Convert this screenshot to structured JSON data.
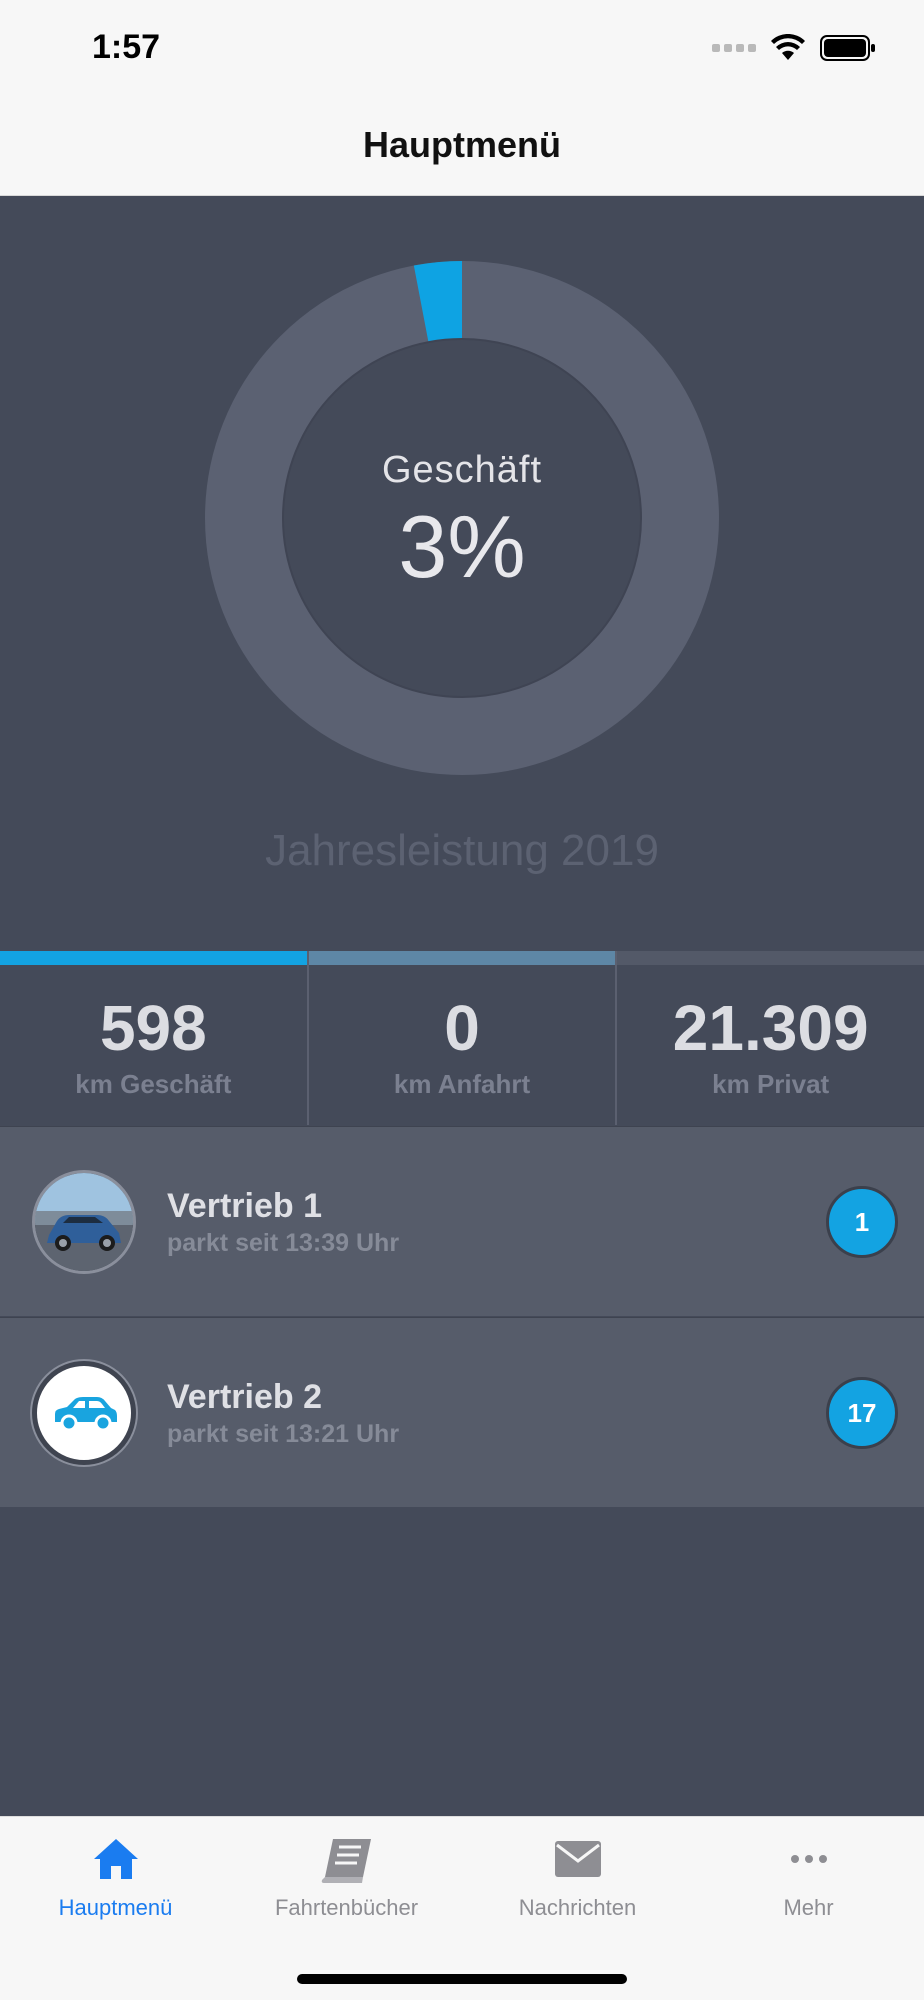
{
  "status_bar": {
    "time": "1:57"
  },
  "nav": {
    "title": "Hauptmenü"
  },
  "donut": {
    "label": "Geschäft",
    "value_text": "3%",
    "fraction": 0.03,
    "year_label": "Jahresleistung 2019"
  },
  "stats": [
    {
      "value": "598",
      "label": "km Geschäft",
      "bar_color": "#13a3e2"
    },
    {
      "value": "0",
      "label": "km Anfahrt",
      "bar_color": "#5e87a6"
    },
    {
      "value": "21.309",
      "label": "km Privat",
      "bar_color": "#535968"
    }
  ],
  "vehicles": [
    {
      "name": "Vertrieb 1",
      "status": "parkt seit 13:39 Uhr",
      "badge": "1",
      "avatar": "car-photo"
    },
    {
      "name": "Vertrieb 2",
      "status": "parkt seit 13:21 Uhr",
      "badge": "17",
      "avatar": "car-icon"
    }
  ],
  "tabs": [
    {
      "label": "Hauptmenü",
      "icon": "home-icon",
      "active": true
    },
    {
      "label": "Fahrtenbücher",
      "icon": "book-icon",
      "active": false
    },
    {
      "label": "Nachrichten",
      "icon": "mail-icon",
      "active": false
    },
    {
      "label": "Mehr",
      "icon": "more-icon",
      "active": false
    }
  ],
  "colors": {
    "accent": "#13a3e2",
    "tab_active": "#1a7cf0",
    "background": "#444a59",
    "ring": "#5b6172"
  }
}
